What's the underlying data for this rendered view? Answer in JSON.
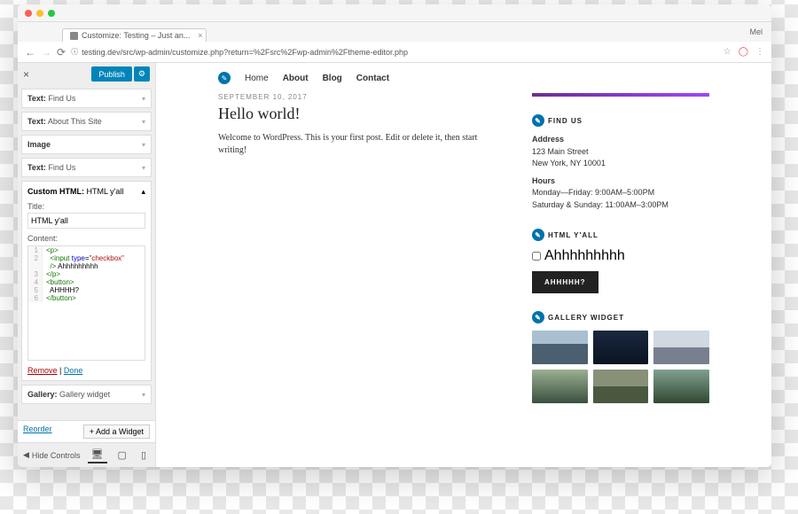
{
  "browser": {
    "tab_title": "Customize: Testing – Just an...",
    "profile": "Mel",
    "url": "testing.dev/src/wp-admin/customize.php?return=%2Fsrc%2Fwp-admin%2Ftheme-editor.php"
  },
  "sidebar": {
    "publish": "Publish",
    "widgets": [
      {
        "prefix": "Text:",
        "label": "Find Us"
      },
      {
        "prefix": "Text:",
        "label": "About This Site"
      },
      {
        "prefix": "Image",
        "label": ""
      },
      {
        "prefix": "Text:",
        "label": "Find Us"
      }
    ],
    "expanded": {
      "prefix": "Custom HTML:",
      "name": "HTML y'all",
      "title_label": "Title:",
      "title_value": "HTML y'all",
      "content_label": "Content:",
      "code": [
        {
          "n": "1",
          "html": "<span class='tag'>&lt;p&gt;</span>"
        },
        {
          "n": "2",
          "html": "  <span class='tag'>&lt;input</span> <span class='attr'>type</span>=<span class='str'>\"checkbox\"</span>"
        },
        {
          "n": " ",
          "html": "  <span class='tag'>/&gt;</span> Ahhhhhhhhh"
        },
        {
          "n": "3",
          "html": "<span class='tag'>&lt;/p&gt;</span>"
        },
        {
          "n": "4",
          "html": "<span class='tag'>&lt;button&gt;</span>"
        },
        {
          "n": "5",
          "html": "  AHHHH?"
        },
        {
          "n": "6",
          "html": "<span class='tag'>&lt;/button&gt;</span>"
        }
      ],
      "remove": "Remove",
      "done": "Done"
    },
    "gallery_widget": {
      "prefix": "Gallery:",
      "label": "Gallery widget"
    },
    "reorder": "Reorder",
    "add_widget": "Add a Widget",
    "hide_controls": "Hide Controls"
  },
  "preview": {
    "nav": [
      "Home",
      "About",
      "Blog",
      "Contact"
    ],
    "post": {
      "date": "SEPTEMBER 10, 2017",
      "title": "Hello world!",
      "body": "Welcome to WordPress. This is your first post. Edit or delete it, then start writing!"
    },
    "find_us": {
      "heading": "FIND US",
      "addr_label": "Address",
      "addr1": "123 Main Street",
      "addr2": "New York, NY 10001",
      "hours_label": "Hours",
      "hours1": "Monday—Friday: 9:00AM–5:00PM",
      "hours2": "Saturday & Sunday: 11:00AM–3:00PM"
    },
    "html_yall": {
      "heading": "HTML Y'ALL",
      "checkbox_label": "Ahhhhhhhhh",
      "button": "AHHHHH?"
    },
    "gallery": {
      "heading": "GALLERY WIDGET"
    }
  }
}
